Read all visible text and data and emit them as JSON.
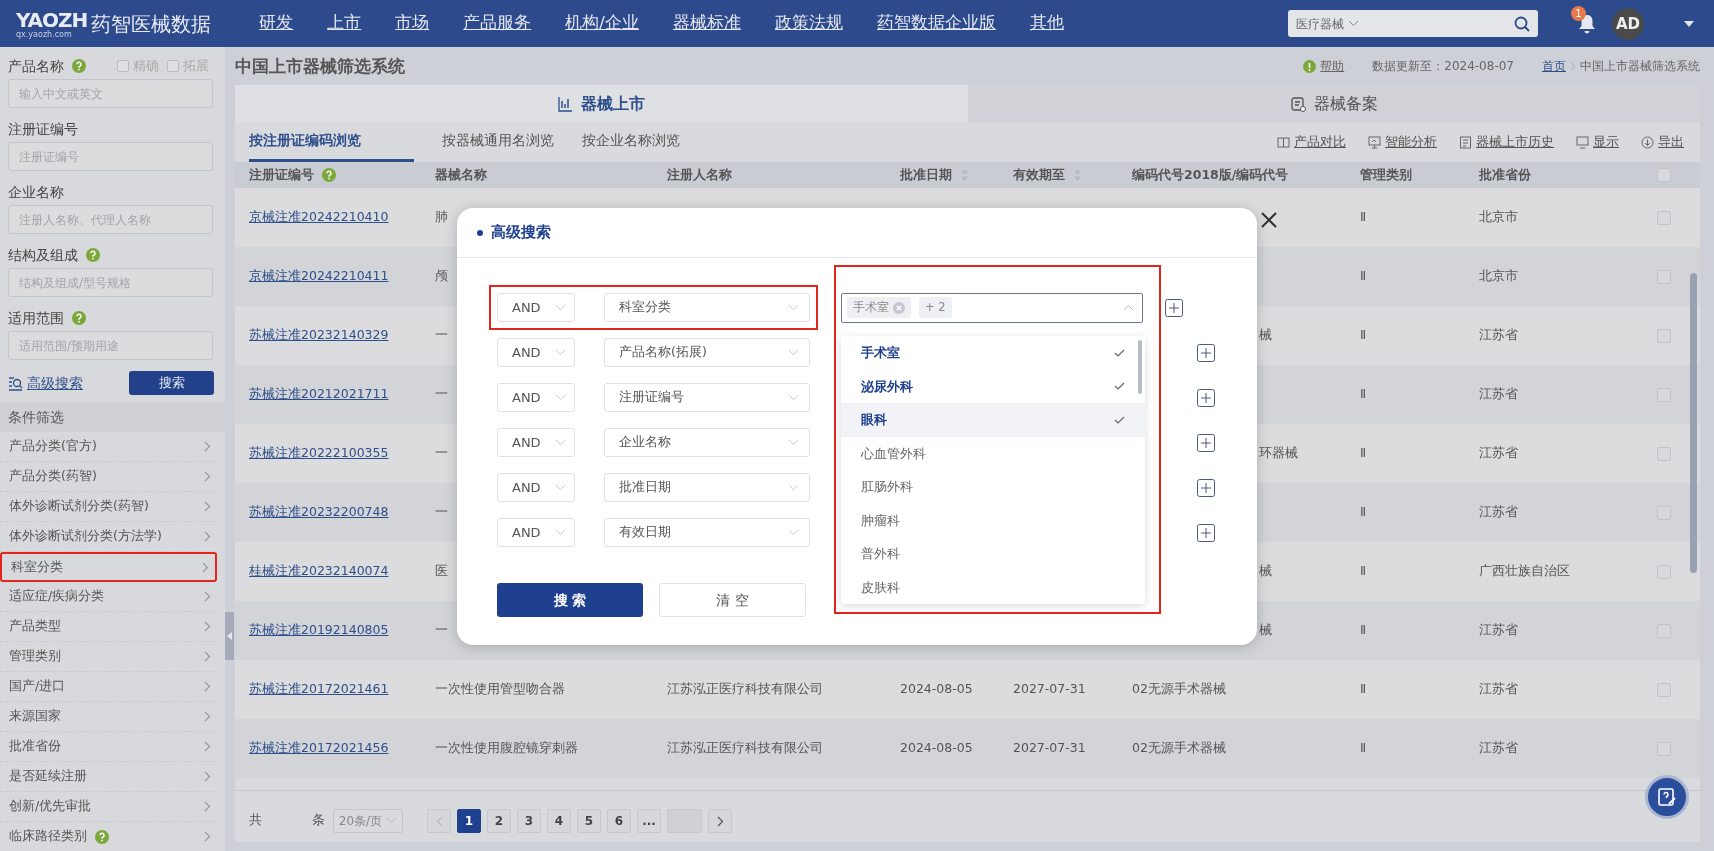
{
  "brand": {
    "logo_text": "YAOZH",
    "logo_subtext": "qx.yaozh.com",
    "name": "药智医械数据"
  },
  "nav": [
    "研发",
    "上市",
    "市场",
    "产品服务",
    "机构/企业",
    "器械标准",
    "政策法规",
    "药智数据企业版",
    "其他"
  ],
  "search": {
    "scope": "医疗器械"
  },
  "notifications": {
    "badge": "1"
  },
  "user": {
    "initials": "AD"
  },
  "sidebar": {
    "fields": [
      {
        "label": "产品名称",
        "help": true,
        "options": [
          {
            "label": "精确",
            "checked": false
          },
          {
            "label": "拓展",
            "checked": false
          }
        ],
        "placeholder": "输入中文或英文"
      },
      {
        "label": "注册证编号",
        "help": false,
        "placeholder": "注册证编号"
      },
      {
        "label": "企业名称",
        "help": false,
        "placeholder": "注册人名称、代理人名称"
      },
      {
        "label": "结构及组成",
        "help": true,
        "placeholder": "结构及组成/型号规格"
      },
      {
        "label": "适用范围",
        "help": true,
        "placeholder": "适用范围/预期用途"
      }
    ],
    "advanced_link": "高级搜索",
    "search_button": "搜索",
    "filter_title": "条件筛选",
    "filters": [
      {
        "label": "产品分类(官方)",
        "help": false,
        "highlighted": false
      },
      {
        "label": "产品分类(药智)",
        "help": false,
        "highlighted": false
      },
      {
        "label": "体外诊断试剂分类(药智)",
        "help": false,
        "highlighted": false
      },
      {
        "label": "体外诊断试剂分类(方法学)",
        "help": false,
        "highlighted": false
      },
      {
        "label": "科室分类",
        "help": false,
        "highlighted": true
      },
      {
        "label": "适应症/疾病分类",
        "help": false,
        "highlighted": false
      },
      {
        "label": "产品类型",
        "help": false,
        "highlighted": false
      },
      {
        "label": "管理类别",
        "help": false,
        "highlighted": false
      },
      {
        "label": "国产/进口",
        "help": false,
        "highlighted": false
      },
      {
        "label": "来源国家",
        "help": false,
        "highlighted": false
      },
      {
        "label": "批准省份",
        "help": false,
        "highlighted": false
      },
      {
        "label": "是否延续注册",
        "help": false,
        "highlighted": false
      },
      {
        "label": "创新/优先审批",
        "help": false,
        "highlighted": false
      },
      {
        "label": "临床路径类别",
        "help": true,
        "highlighted": false
      }
    ]
  },
  "page_title": "中国上市器械筛选系统",
  "help_link": "帮助",
  "updated": "数据更新至：2024-08-07",
  "breadcrumb": [
    "首页",
    "中国上市器械筛选系统"
  ],
  "main_tabs": [
    {
      "label": "器械上市",
      "selected": true
    },
    {
      "label": "器械备案",
      "selected": false
    }
  ],
  "sub_tabs": [
    {
      "label": "按注册证编码浏览",
      "selected": true
    },
    {
      "label": "按器械通用名浏览",
      "selected": false
    },
    {
      "label": "按企业名称浏览",
      "selected": false
    }
  ],
  "tools": [
    "产品对比",
    "智能分析",
    "器械上市历史",
    "显示",
    "导出"
  ],
  "table": {
    "all_checked": false,
    "columns": [
      {
        "label": "注册证编号",
        "help": true,
        "sortable": false
      },
      {
        "label": "器械名称",
        "help": false,
        "sortable": false
      },
      {
        "label": "注册人名称",
        "help": false,
        "sortable": false
      },
      {
        "label": "批准日期",
        "help": false,
        "sortable": true
      },
      {
        "label": "有效期至",
        "help": false,
        "sortable": true
      },
      {
        "label": "编码代号2018版/编码代号",
        "help": false,
        "sortable": false
      },
      {
        "label": "管理类别",
        "help": false,
        "sortable": false
      },
      {
        "label": "批准省份",
        "help": false,
        "sortable": false
      }
    ],
    "rows": [
      {
        "reg_no": "京械注准20242210410",
        "name": "肺",
        "class": "Ⅱ",
        "province": "北京市",
        "checked": false
      },
      {
        "reg_no": "京械注准20242210411",
        "name": "颅",
        "class": "Ⅱ",
        "province": "北京市",
        "checked": false
      },
      {
        "reg_no": "苏械注准20232140329",
        "name": "一",
        "code": "械",
        "class": "Ⅱ",
        "province": "江苏省",
        "checked": false
      },
      {
        "reg_no": "苏械注准20212021711",
        "name": "一",
        "class": "Ⅱ",
        "province": "江苏省",
        "checked": false
      },
      {
        "reg_no": "苏械注准20222100355",
        "name": "一",
        "code": "环器械",
        "class": "Ⅱ",
        "province": "江苏省",
        "checked": false
      },
      {
        "reg_no": "苏械注准20232200748",
        "name": "一",
        "class": "Ⅱ",
        "province": "江苏省",
        "checked": false
      },
      {
        "reg_no": "桂械注准20232140074",
        "name": "医",
        "code": "械",
        "class": "Ⅱ",
        "province": "广西壮族自治区",
        "checked": false
      },
      {
        "reg_no": "苏械注准20192140805",
        "name": "一",
        "code": "械",
        "class": "Ⅱ",
        "province": "江苏省",
        "checked": false
      },
      {
        "reg_no": "苏械注准20172021461",
        "name": "一次性使用管型吻合器",
        "registrant": "江苏泓正医疗科技有限公司",
        "approved": "2024-08-05",
        "expires": "2027-07-31",
        "code": "02无源手术器械",
        "class": "Ⅱ",
        "province": "江苏省",
        "checked": false
      },
      {
        "reg_no": "苏械注准20172021456",
        "name": "一次性使用腹腔镜穿刺器",
        "registrant": "江苏泓正医疗科技有限公司",
        "approved": "2024-08-05",
        "expires": "2027-07-31",
        "code": "02无源手术器械",
        "class": "Ⅱ",
        "province": "江苏省",
        "checked": false
      }
    ]
  },
  "pagination": {
    "total_prefix": "共",
    "total_suffix": "条",
    "page_size": "20条/页",
    "pages": [
      {
        "label": "1",
        "selected": true
      },
      {
        "label": "2",
        "selected": false
      },
      {
        "label": "3",
        "selected": false
      },
      {
        "label": "4",
        "selected": false
      },
      {
        "label": "5",
        "selected": false
      },
      {
        "label": "6",
        "selected": false
      },
      {
        "label": "...",
        "selected": false
      }
    ]
  },
  "modal": {
    "title": "高级搜索",
    "rows": [
      {
        "operator": "AND",
        "field": "科室分类",
        "highlighted": true
      },
      {
        "operator": "AND",
        "field": "产品名称(拓展)",
        "highlighted": false
      },
      {
        "operator": "AND",
        "field": "注册证编号",
        "highlighted": false
      },
      {
        "operator": "AND",
        "field": "企业名称",
        "highlighted": false
      },
      {
        "operator": "AND",
        "field": "批准日期",
        "highlighted": false
      },
      {
        "operator": "AND",
        "field": "有效日期",
        "highlighted": false
      }
    ],
    "value_select": {
      "highlighted": true,
      "tags": [
        "手术室"
      ],
      "more": "+ 2",
      "options": [
        {
          "label": "手术室",
          "selected": true,
          "hovered": false
        },
        {
          "label": "泌尿外科",
          "selected": true,
          "hovered": false
        },
        {
          "label": "眼科",
          "selected": true,
          "hovered": true
        },
        {
          "label": "心血管外科",
          "selected": false,
          "hovered": false
        },
        {
          "label": "肛肠外科",
          "selected": false,
          "hovered": false
        },
        {
          "label": "肿瘤科",
          "selected": false,
          "hovered": false
        },
        {
          "label": "普外科",
          "selected": false,
          "hovered": false
        },
        {
          "label": "皮肤科",
          "selected": false,
          "hovered": false
        }
      ]
    },
    "search_button": "搜 索",
    "clear_button": "清 空"
  }
}
